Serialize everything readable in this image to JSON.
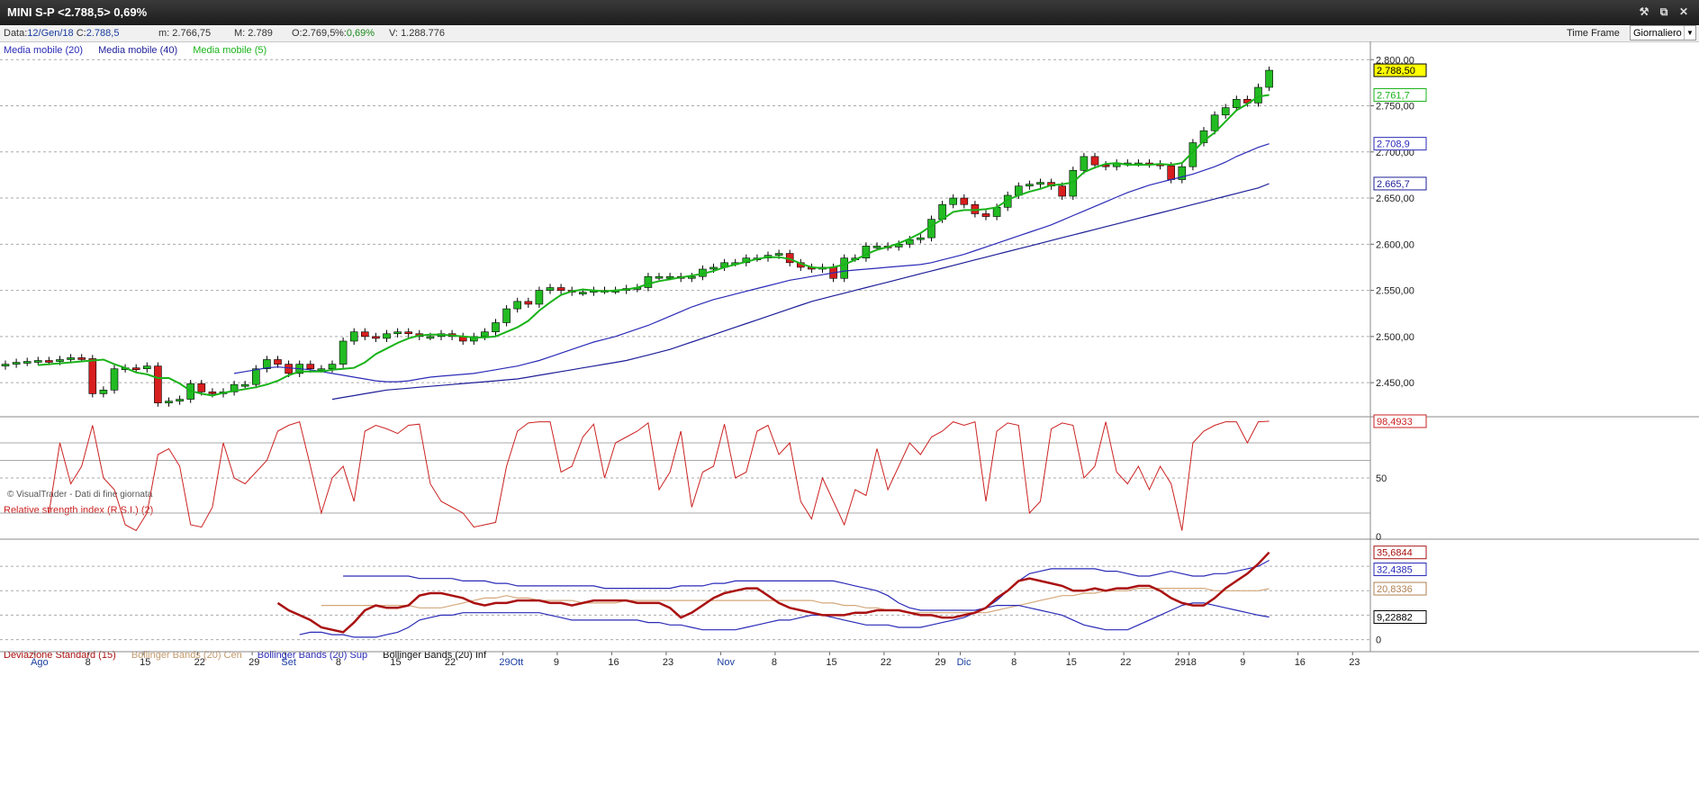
{
  "window": {
    "title": "MINI S-P <2.788,5> 0,69%",
    "buttons": [
      "wrench-icon",
      "restore-icon",
      "close-icon"
    ]
  },
  "infobar": {
    "data_label": "Data:",
    "data_value": "12/Gen/18",
    "c_label": "C:",
    "c_value": "2.788,5",
    "m_label": "m:",
    "m_value": "2.766,75",
    "M_label": "M:",
    "M_value": "2.789",
    "o_label": "O:",
    "o_value": "2.769,5",
    "pct_label": "%:",
    "pct_value": "0,69%",
    "v_label": "V:",
    "v_value": "1.288.776",
    "timeframe_label": "Time Frame",
    "timeframe_value": "Giornaliero"
  },
  "price_panel": {
    "legend": [
      "Media mobile (20)",
      "Media mobile (40)",
      "Media mobile (5)"
    ],
    "watermark": "© VisualTrader - Dati di fine giornata",
    "value_tags": {
      "last": "2.788,50",
      "ma5": "2.761,7",
      "ma20": "2.708,9",
      "ma40": "2.665,7"
    }
  },
  "rsi_panel": {
    "legend": "Relative strength index (R.S.I.) (2)",
    "value_tag": "98,4933"
  },
  "bb_panel": {
    "legend": [
      "Deviazione Standard (15)",
      "Bollinger Bands (20) Cen",
      "Bollinger Bands (20) Sup",
      "Bollinger Bands (20) Inf"
    ],
    "value_tags": {
      "dev": "35,6844",
      "sup": "32,4385",
      "cen": "20,8336",
      "inf": "9,22882"
    }
  },
  "colors": {
    "up": "#22bb22",
    "down": "#d81e1e",
    "ma5": "#19b319",
    "ma20": "#2a2ab8",
    "ma40": "#1e1e99",
    "rsi": "#cc2222",
    "dev": "#aa1111",
    "bb_cen": "#d4a87a",
    "bb_band": "#2a2ab8",
    "tag_last_bg": "#ffff00"
  },
  "chart_data": [
    {
      "type": "candlestick",
      "title": "MINI S-P",
      "ylim": [
        2415,
        2810
      ],
      "y_ticks": [
        "2.800,00",
        "2.750,00",
        "2.700,00",
        "2.650,00",
        "2.600,00",
        "2.550,00",
        "2.500,00",
        "2.450,00"
      ],
      "y_tick_values": [
        2800,
        2750,
        2700,
        2650,
        2600,
        2550,
        2500,
        2450
      ],
      "x_tick_labels": [
        "Ago",
        "8",
        "15",
        "22",
        "29",
        "Set",
        "8",
        "15",
        "22",
        "29Ott",
        "9",
        "16",
        "23",
        "Nov",
        "8",
        "15",
        "22",
        "29",
        "Dic",
        "8",
        "15",
        "22",
        "29",
        "18",
        "9",
        "16",
        "23"
      ],
      "x_tick_index": [
        1,
        6,
        11,
        16,
        21,
        24,
        29,
        34,
        39,
        44,
        49,
        54,
        59,
        64,
        69,
        74,
        79,
        84,
        86,
        91,
        96,
        101,
        106,
        107,
        112,
        117,
        122
      ],
      "close": [
        2470,
        2472,
        2473,
        2474,
        2473,
        2475,
        2477,
        2476,
        2438,
        2442,
        2465,
        2466,
        2465,
        2468,
        2428,
        2430,
        2432,
        2449,
        2440,
        2438,
        2440,
        2448,
        2448,
        2465,
        2475,
        2470,
        2460,
        2470,
        2465,
        2465,
        2470,
        2495,
        2505,
        2500,
        2498,
        2503,
        2505,
        2503,
        2500,
        2500,
        2503,
        2500,
        2495,
        2500,
        2505,
        2515,
        2530,
        2538,
        2535,
        2550,
        2553,
        2550,
        2548,
        2548,
        2550,
        2550,
        2550,
        2552,
        2553,
        2565,
        2565,
        2565,
        2563,
        2565,
        2573,
        2575,
        2580,
        2580,
        2585,
        2585,
        2588,
        2590,
        2580,
        2575,
        2573,
        2575,
        2563,
        2585,
        2585,
        2598,
        2598,
        2597,
        2600,
        2605,
        2607,
        2627,
        2643,
        2650,
        2643,
        2633,
        2630,
        2640,
        2653,
        2663,
        2665,
        2667,
        2663,
        2652,
        2680,
        2695,
        2686,
        2684,
        2688,
        2688,
        2688,
        2687,
        2685,
        2670,
        2684,
        2710,
        2723,
        2740,
        2748,
        2757,
        2753,
        2770,
        2788.5
      ],
      "open_prev_note": "open = previous close, candle colour by close vs previous close",
      "ma5": [
        2469,
        2470,
        2471,
        2472,
        2473,
        2474,
        2475,
        2470,
        2466,
        2461,
        2459,
        2455,
        2455,
        2449,
        2441,
        2438,
        2436,
        2439,
        2441,
        2443,
        2445,
        2448,
        2452,
        2458,
        2462,
        2462,
        2462,
        2464,
        2465,
        2466,
        2472,
        2481,
        2487,
        2493,
        2498,
        2501,
        2502,
        2502,
        2501,
        2500,
        2499,
        2499,
        2500,
        2505,
        2510,
        2517,
        2528,
        2537,
        2545,
        2549,
        2551,
        2550,
        2549,
        2550,
        2551,
        2553,
        2557,
        2560,
        2562,
        2564,
        2566,
        2568,
        2571,
        2575,
        2578,
        2581,
        2584,
        2586,
        2586,
        2584,
        2579,
        2575,
        2574,
        2575,
        2578,
        2583,
        2589,
        2594,
        2597,
        2601,
        2606,
        2612,
        2620,
        2627,
        2635,
        2637,
        2637,
        2638,
        2640,
        2648,
        2653,
        2657,
        2660,
        2664,
        2665,
        2667,
        2678,
        2683,
        2687,
        2688,
        2686,
        2686,
        2686,
        2687,
        2686,
        2688,
        2700,
        2712,
        2721,
        2733,
        2745,
        2752,
        2760,
        2761.7
      ],
      "ma20": [
        2460,
        2462,
        2464,
        2466,
        2467,
        2466,
        2465,
        2464,
        2462,
        2460,
        2458,
        2456,
        2454,
        2452,
        2451,
        2451,
        2452,
        2454,
        2456,
        2457,
        2458,
        2459,
        2460,
        2462,
        2464,
        2466,
        2468,
        2471,
        2474,
        2478,
        2482,
        2486,
        2490,
        2494,
        2497,
        2500,
        2504,
        2508,
        2512,
        2517,
        2522,
        2527,
        2532,
        2536,
        2540,
        2543,
        2546,
        2549,
        2552,
        2555,
        2558,
        2561,
        2563,
        2565,
        2567,
        2569,
        2571,
        2572,
        2573,
        2574,
        2575,
        2576,
        2577,
        2578,
        2580,
        2583,
        2586,
        2589,
        2593,
        2597,
        2601,
        2605,
        2609,
        2613,
        2617,
        2621,
        2626,
        2631,
        2636,
        2641,
        2646,
        2651,
        2656,
        2660,
        2664,
        2667,
        2670,
        2673,
        2676,
        2680,
        2684,
        2689,
        2695,
        2700,
        2705,
        2708.9
      ],
      "ma20_start": 0,
      "ma40": [
        2432,
        2434,
        2436,
        2438,
        2440,
        2442,
        2443,
        2444,
        2445,
        2446,
        2447,
        2448,
        2449,
        2450,
        2451,
        2452,
        2453,
        2454,
        2456,
        2458,
        2460,
        2462,
        2464,
        2466,
        2468,
        2470,
        2472,
        2474,
        2477,
        2480,
        2483,
        2486,
        2490,
        2494,
        2498,
        2502,
        2506,
        2510,
        2514,
        2518,
        2522,
        2526,
        2530,
        2534,
        2538,
        2541,
        2544,
        2547,
        2550,
        2553,
        2556,
        2559,
        2562,
        2565,
        2568,
        2571,
        2574,
        2577,
        2580,
        2583,
        2586,
        2589,
        2592,
        2595,
        2598,
        2601,
        2604,
        2607,
        2610,
        2613,
        2616,
        2619,
        2622,
        2625,
        2628,
        2631,
        2634,
        2637,
        2640,
        2643,
        2646,
        2649,
        2652,
        2655,
        2658,
        2661,
        2665.7
      ]
    },
    {
      "type": "line",
      "title": "Relative strength index (R.S.I.) (2)",
      "ylim": [
        0,
        100
      ],
      "y_ticks": [
        "50",
        "0"
      ],
      "series": [
        {
          "name": "Relative strength index (R.S.I.) (2)",
          "values": [
            20,
            80,
            45,
            60,
            95,
            50,
            40,
            10,
            5,
            20,
            70,
            75,
            60,
            10,
            8,
            25,
            80,
            50,
            45,
            55,
            65,
            90,
            95,
            98,
            60,
            20,
            50,
            60,
            30,
            90,
            95,
            92,
            88,
            95,
            96,
            45,
            30,
            25,
            20,
            8,
            10,
            12,
            60,
            90,
            97,
            98,
            98,
            55,
            60,
            85,
            96,
            50,
            80,
            85,
            90,
            97,
            40,
            55,
            90,
            25,
            55,
            60,
            96,
            50,
            55,
            90,
            95,
            70,
            80,
            30,
            15,
            50,
            30,
            10,
            40,
            35,
            75,
            40,
            60,
            80,
            70,
            85,
            90,
            98,
            95,
            98,
            30,
            90,
            97,
            95,
            20,
            30,
            92,
            97,
            95,
            50,
            60,
            98,
            55,
            45,
            60,
            40,
            60,
            45,
            5,
            80,
            90,
            95,
            98,
            98,
            80,
            98,
            98.49
          ]
        }
      ]
    },
    {
      "type": "line",
      "title": "Deviazione Standard (15) / Bollinger Bands (20)",
      "ylim": [
        -2,
        40
      ],
      "y_ticks": [
        "30",
        "20",
        "10",
        "0"
      ],
      "series": [
        {
          "name": "Deviazione Standard (15)",
          "values": [
            15,
            12,
            10,
            8,
            5,
            4,
            3,
            7,
            12,
            14,
            13,
            13,
            14,
            18,
            19,
            19,
            18,
            17,
            15,
            14,
            15,
            15,
            16,
            16,
            16,
            15,
            15,
            14,
            15,
            16,
            16,
            16,
            16,
            15,
            15,
            15,
            13,
            9,
            11,
            14,
            17,
            19,
            20,
            21,
            21,
            18,
            15,
            13,
            12,
            11,
            10,
            10,
            10,
            11,
            11,
            12,
            12,
            12,
            11,
            10,
            10,
            9,
            9,
            10,
            11,
            13,
            17,
            20,
            24,
            25,
            24,
            23,
            22,
            20,
            20,
            21,
            20,
            21,
            21,
            22,
            22,
            20,
            17,
            15,
            14,
            14,
            17,
            21,
            24,
            27,
            31,
            35.68
          ]
        },
        {
          "name": "Bollinger Bands (20) Cen",
          "values": [
            14,
            14,
            14,
            14,
            14,
            14,
            14,
            14,
            14,
            13,
            13,
            13,
            14,
            15,
            16,
            17,
            17,
            18,
            17,
            17,
            16,
            16,
            16,
            16,
            15,
            15,
            15,
            15,
            16,
            16,
            16,
            16,
            16,
            16,
            16,
            16,
            16,
            16,
            16,
            16,
            16,
            16,
            16,
            16,
            16,
            16,
            15,
            15,
            14,
            14,
            13,
            13,
            12,
            12,
            11,
            11,
            11,
            11,
            11,
            11,
            11,
            11,
            12,
            13,
            14,
            15,
            16,
            17,
            18,
            18,
            19,
            19,
            20,
            20,
            20,
            21,
            21,
            21,
            21,
            21,
            21,
            21,
            20,
            20,
            20,
            20,
            20,
            20.83
          ]
        },
        {
          "name": "Bollinger Bands (20) Sup",
          "values": [
            26,
            26,
            26,
            26,
            26,
            26,
            26,
            25,
            25,
            25,
            25,
            24,
            24,
            24,
            23,
            23,
            22,
            22,
            22,
            22,
            22,
            22,
            22,
            22,
            21,
            21,
            21,
            21,
            21,
            21,
            21,
            22,
            22,
            22,
            23,
            23,
            24,
            24,
            24,
            24,
            24,
            24,
            24,
            24,
            24,
            24,
            23,
            22,
            21,
            20,
            18,
            15,
            13,
            12,
            12,
            12,
            12,
            12,
            12,
            13,
            16,
            20,
            24,
            27,
            28,
            29,
            29,
            29,
            29,
            29,
            28,
            28,
            27,
            26,
            26,
            27,
            28,
            27,
            26,
            26,
            27,
            27,
            28,
            29,
            30,
            32.44
          ]
        },
        {
          "name": "Bollinger Bands (20) Inf",
          "values": [
            2,
            3,
            3,
            2,
            2,
            1,
            1,
            1,
            2,
            3,
            5,
            8,
            9,
            10,
            10,
            11,
            11,
            11,
            11,
            11,
            11,
            11,
            11,
            10,
            9,
            8,
            8,
            8,
            8,
            8,
            8,
            8,
            7,
            7,
            6,
            6,
            5,
            4,
            4,
            4,
            4,
            5,
            6,
            7,
            8,
            8,
            9,
            10,
            10,
            9,
            8,
            7,
            6,
            6,
            6,
            5,
            5,
            5,
            6,
            7,
            8,
            9,
            11,
            13,
            14,
            14,
            14,
            13,
            12,
            11,
            10,
            8,
            6,
            5,
            4,
            4,
            4,
            6,
            8,
            10,
            12,
            14,
            15,
            15,
            14,
            13,
            12,
            11,
            10,
            9.23
          ]
        }
      ]
    }
  ]
}
